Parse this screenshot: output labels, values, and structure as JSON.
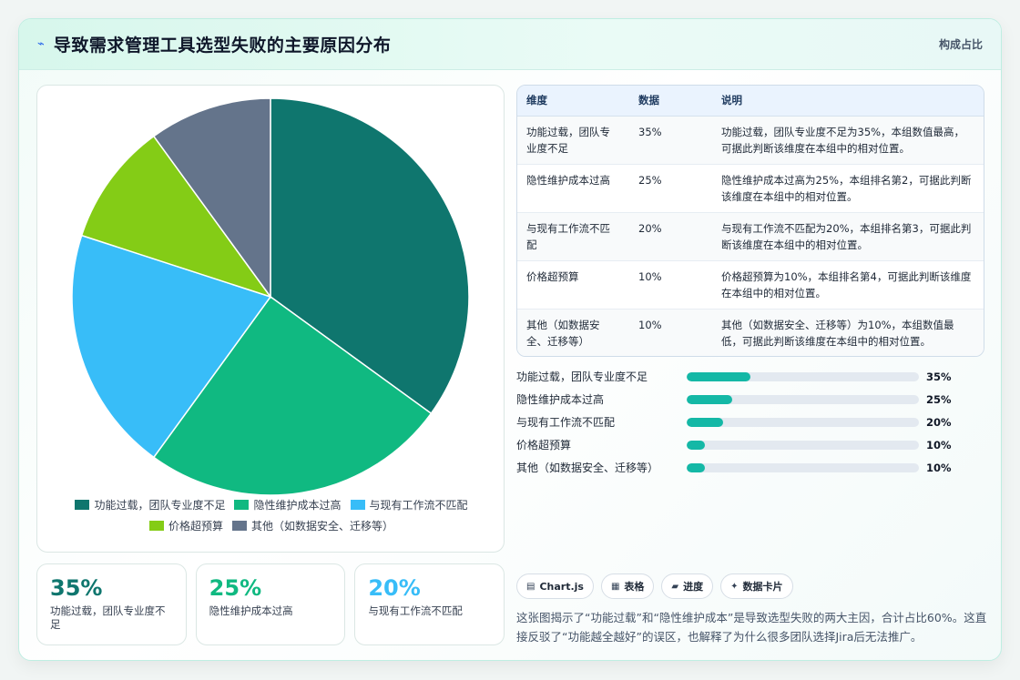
{
  "header": {
    "icon": "lightning-icon",
    "title": "导致需求管理工具选型失败的主要原因分布",
    "right_label": "构成占比"
  },
  "chart_data": {
    "type": "pie",
    "categories": [
      "功能过载，团队专业度不足",
      "隐性维护成本过高",
      "与现有工作流不匹配",
      "价格超预算",
      "其他（如数据安全、迁移等）"
    ],
    "values": [
      35,
      25,
      20,
      10,
      10
    ],
    "colors": [
      "#0f766e",
      "#10b981",
      "#38bdf8",
      "#84cc16",
      "#64748b"
    ],
    "legend_position": "bottom"
  },
  "kpis": [
    {
      "value": "35%",
      "label": "功能过载，团队专业度不足",
      "color": "#0f766e"
    },
    {
      "value": "25%",
      "label": "隐性维护成本过高",
      "color": "#10b981"
    },
    {
      "value": "20%",
      "label": "与现有工作流不匹配",
      "color": "#38bdf8"
    }
  ],
  "table": {
    "headers": [
      "维度",
      "数据",
      "说明"
    ],
    "rows": [
      {
        "dim": "功能过载，团队专业度不足",
        "data": "35%",
        "desc": "功能过载，团队专业度不足为35%，本组数值最高，可据此判断该维度在本组中的相对位置。"
      },
      {
        "dim": "隐性维护成本过高",
        "data": "25%",
        "desc": "隐性维护成本过高为25%，本组排名第2，可据此判断该维度在本组中的相对位置。"
      },
      {
        "dim": "与现有工作流不匹配",
        "data": "20%",
        "desc": "与现有工作流不匹配为20%，本组排名第3，可据此判断该维度在本组中的相对位置。"
      },
      {
        "dim": "价格超预算",
        "data": "10%",
        "desc": "价格超预算为10%，本组排名第4，可据此判断该维度在本组中的相对位置。"
      },
      {
        "dim": "其他（如数据安全、迁移等）",
        "data": "10%",
        "desc": "其他（如数据安全、迁移等）为10%，本组数值最低，可据此判断该维度在本组中的相对位置。"
      }
    ]
  },
  "bars": [
    {
      "label": "功能过载，团队专业度不足",
      "value": "35%",
      "fraction": 0.35
    },
    {
      "label": "隐性维护成本过高",
      "value": "25%",
      "fraction": 0.25
    },
    {
      "label": "与现有工作流不匹配",
      "value": "20%",
      "fraction": 0.2
    },
    {
      "label": "价格超预算",
      "value": "10%",
      "fraction": 0.1
    },
    {
      "label": "其他（如数据安全、迁移等）",
      "value": "10%",
      "fraction": 0.1
    }
  ],
  "tags": [
    {
      "icon": "chart-icon",
      "label": "Chart.js"
    },
    {
      "icon": "table-icon",
      "label": "表格"
    },
    {
      "icon": "progress-icon",
      "label": "进度"
    },
    {
      "icon": "sparkle-icon",
      "label": "数据卡片"
    }
  ],
  "summary": "这张图揭示了“功能过载”和“隐性维护成本”是导致选型失败的两大主因，合计占比60%。这直接反驳了“功能越全越好”的误区，也解释了为什么很多团队选择Jira后无法推广。"
}
